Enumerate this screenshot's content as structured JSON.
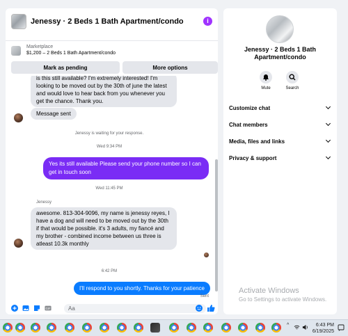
{
  "chat": {
    "title": "Jenessy · 2 Beds 1 Bath Apartment/condo",
    "info_icon": "info-icon",
    "marketplace_label": "Marketplace",
    "listing": "$1,200 – 2 Beds 1 Bath Apartment/condo",
    "mark_pending": "Mark as pending",
    "more_options": "More options",
    "messages": {
      "msg1": "is this still available? I'm extremely interested! I'm looking to be moved out by the 30th of june the latest and would love to hear back from you whenever you get the chance. Thank you.",
      "msg2": "Message sent",
      "waiting": "Jenessy is waiting for your response.",
      "time1": "Wed 9:34 PM",
      "msg3": "Yes its still available Please send your phone number so I can get in touch soon",
      "time2": "Wed 11:45 PM",
      "sender": "Jenessy",
      "msg4": "awesome. 813-304-9096, my name is jenessy reyes, I have a dog and will need to be moved out by the 30th if that would be possible. it's 3 adults, my fiancé and my brother - combined income between us three is atleast 10.3k monthly",
      "time3": "6:42 PM",
      "msg5": "I'll respond to you shortly. Thanks for your patience",
      "sent": "Sent"
    },
    "composer_placeholder": "Aa"
  },
  "info": {
    "title": "Jenessy · 2 Beds 1 Bath Apartment/condo",
    "mute": "Mute",
    "search": "Search",
    "menu": [
      "Customize chat",
      "Chat members",
      "Media, files and links",
      "Privacy & support"
    ]
  },
  "watermark": {
    "line1": "Activate Windows",
    "line2": "Go to Settings to activate Windows."
  },
  "taskbar": {
    "time": "6:43 PM",
    "date": "6/19/2025",
    "tray_chevron": "^"
  },
  "colors": {
    "outgoing_bubble": "#7a2cf5",
    "last_bubble": "#0a7cff",
    "incoming_bubble": "#e4e6eb"
  }
}
